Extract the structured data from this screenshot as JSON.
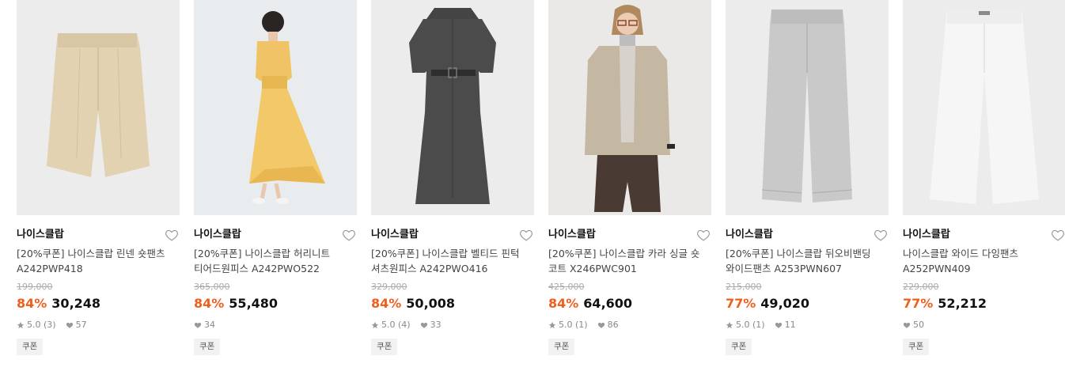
{
  "products": [
    {
      "brand": "나이스클랍",
      "title_line1": "[20%쿠폰] 나이스클랍 린넨 숏팬츠",
      "title_line2": "A242PWP418",
      "original_price": "199,000",
      "discount_rate": "84%",
      "sale_price": "30,248",
      "rating": "5.0 (3)",
      "likes": "57",
      "coupon": "쿠폰",
      "image_icon": "linen-shorts-image",
      "has_rating": true
    },
    {
      "brand": "나이스클랍",
      "title_line1": "[20%쿠폰] 나이스클랍 허리니트",
      "title_line2": "티어드원피스 A242PWO522",
      "original_price": "365,000",
      "discount_rate": "84%",
      "sale_price": "55,480",
      "rating": "",
      "likes": "34",
      "coupon": "쿠폰",
      "image_icon": "yellow-dress-model-image",
      "has_rating": false
    },
    {
      "brand": "나이스클랍",
      "title_line1": "[20%쿠폰] 나이스클랍 벨티드 핀턱",
      "title_line2": "셔츠원피스 A242PWO416",
      "original_price": "329,000",
      "discount_rate": "84%",
      "sale_price": "50,008",
      "rating": "5.0 (4)",
      "likes": "33",
      "coupon": "쿠폰",
      "image_icon": "shirt-dress-image",
      "has_rating": true
    },
    {
      "brand": "나이스클랍",
      "title_line1": "[20%쿠폰] 나이스클랍 카라 싱글 숏",
      "title_line2": "코트 X246PWC901",
      "original_price": "425,000",
      "discount_rate": "84%",
      "sale_price": "64,600",
      "rating": "5.0 (1)",
      "likes": "86",
      "coupon": "쿠폰",
      "image_icon": "short-coat-model-image",
      "has_rating": true
    },
    {
      "brand": "나이스클랍",
      "title_line1": "[20%쿠폰] 나이스클랍 뒤오비밴딩",
      "title_line2": "와이드팬츠 A253PWN607",
      "original_price": "215,000",
      "discount_rate": "77%",
      "sale_price": "49,020",
      "rating": "5.0 (1)",
      "likes": "11",
      "coupon": "쿠폰",
      "image_icon": "grey-wide-pants-image",
      "has_rating": true
    },
    {
      "brand": "나이스클랍",
      "title_line1": "나이스클랍 와이드 다잉팬츠",
      "title_line2": "A252PWN409",
      "original_price": "229,000",
      "discount_rate": "77%",
      "sale_price": "52,212",
      "rating": "",
      "likes": "50",
      "coupon": "쿠폰",
      "image_icon": "white-wide-pants-image",
      "has_rating": false
    }
  ],
  "colors": {
    "discount": "#f0601c",
    "image_bg": "#ececec",
    "coupon_bg": "#f2f2f2"
  },
  "icons": {
    "like": "heart-outline-icon",
    "rating": "star-icon",
    "likes_count": "heart-filled-icon"
  }
}
